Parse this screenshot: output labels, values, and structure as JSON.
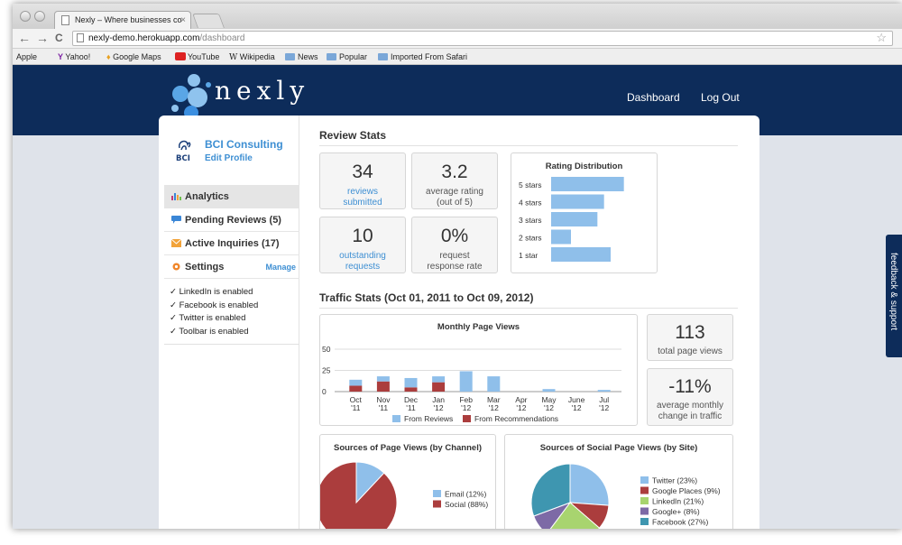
{
  "browser": {
    "tab_title": "Nexly – Where businesses co",
    "tab_close": "×",
    "nav_back": "←",
    "nav_forward": "→",
    "nav_reload": "C",
    "url_host": "nexly-demo.herokuapp.com",
    "url_path": "/dashboard",
    "bookmarks": [
      "Apple",
      "Yahoo!",
      "Google Maps",
      "YouTube",
      "Wikipedia",
      "News",
      "Popular",
      "Imported From Safari"
    ]
  },
  "header": {
    "logo_text": "nexly",
    "nav": [
      "Dashboard",
      "Log Out"
    ],
    "feedback_tab": "feedback & support"
  },
  "sidebar": {
    "company_name": "BCI Consulting",
    "edit_profile": "Edit Profile",
    "logo_text": "BCI",
    "menu": [
      {
        "label": "Analytics",
        "icon": "bar-chart-icon",
        "color": "#c03a7a"
      },
      {
        "label": "Pending Reviews (5)",
        "icon": "speech-bubble-icon",
        "color": "#3a86d6"
      },
      {
        "label": "Active Inquiries (17)",
        "icon": "envelope-icon",
        "color": "#f2a33a"
      },
      {
        "label": "Settings",
        "icon": "gear-icon",
        "color": "#f0862a"
      }
    ],
    "manage_link": "Manage",
    "integrations": [
      "✓ LinkedIn is enabled",
      "✓ Facebook is enabled",
      "✓ Twitter is enabled",
      "✓ Toolbar is enabled"
    ]
  },
  "review_stats": {
    "title": "Review Stats",
    "reviews_submitted": {
      "value": "34",
      "label1": "reviews",
      "label2": "submitted"
    },
    "average_rating": {
      "value": "3.2",
      "label1": "average rating",
      "label2": "(out of 5)"
    },
    "outstanding_requests": {
      "value": "10",
      "label1": "outstanding",
      "label2": "requests"
    },
    "response_rate": {
      "value": "0%",
      "label1": "request",
      "label2": "response rate"
    }
  },
  "traffic_stats": {
    "title": "Traffic Stats (Oct 01, 2011 to Oct 09, 2012)",
    "total_page_views": {
      "value": "113",
      "label": "total page views"
    },
    "avg_monthly_change": {
      "value": "-11%",
      "label1": "average monthly",
      "label2": "change in traffic"
    }
  },
  "colors": {
    "blue": "#8fbfea",
    "red": "#ab3d3d",
    "green": "#a8d46f",
    "purple": "#7d6aa6",
    "teal": "#3e96b0",
    "brand_navy": "#0d2c5a"
  },
  "chart_data": [
    {
      "type": "bar",
      "title": "Rating Distribution",
      "categories": [
        "5 stars",
        "4 stars",
        "3 stars",
        "2 stars",
        "1 star"
      ],
      "values": [
        11,
        8,
        7,
        3,
        9
      ],
      "orientation": "horizontal"
    },
    {
      "type": "bar",
      "title": "Monthly Page Views",
      "categories": [
        "Oct '11",
        "Nov '11",
        "Dec '11",
        "Jan '12",
        "Feb '12",
        "Mar '12",
        "Apr '12",
        "May '12",
        "June '12",
        "Jul '12"
      ],
      "tick_top": [
        "Oct",
        "Nov",
        "Dec",
        "Jan",
        "Feb",
        "Mar",
        "Apr",
        "May",
        "June",
        "Jul"
      ],
      "tick_bottom": [
        "'11",
        "'11",
        "'11",
        "'12",
        "'12",
        "'12",
        "'12",
        "'12",
        "'12",
        "'12"
      ],
      "stacked": true,
      "series": [
        {
          "name": "From Reviews",
          "values": [
            7,
            6,
            11,
            7,
            24,
            18,
            0,
            3,
            0,
            2
          ]
        },
        {
          "name": "From Recommendations",
          "values": [
            7,
            12,
            5,
            11,
            0,
            0,
            0,
            0,
            0,
            0
          ]
        }
      ],
      "ylim": [
        0,
        50
      ],
      "yticks": [
        0,
        25,
        50
      ],
      "legend": "bottom"
    },
    {
      "type": "pie",
      "title": "Sources of Page Views (by Channel)",
      "labels": [
        "Email (12%)",
        "Social (88%)"
      ],
      "values": [
        12,
        88
      ],
      "legend": "right"
    },
    {
      "type": "pie",
      "title": "Sources of Social Page Views (by Site)",
      "labels": [
        "Twitter (23%)",
        "Google Places (9%)",
        "LinkedIn (21%)",
        "Google+ (8%)",
        "Facebook (27%)"
      ],
      "values": [
        23,
        9,
        21,
        8,
        27
      ],
      "legend": "right"
    }
  ]
}
